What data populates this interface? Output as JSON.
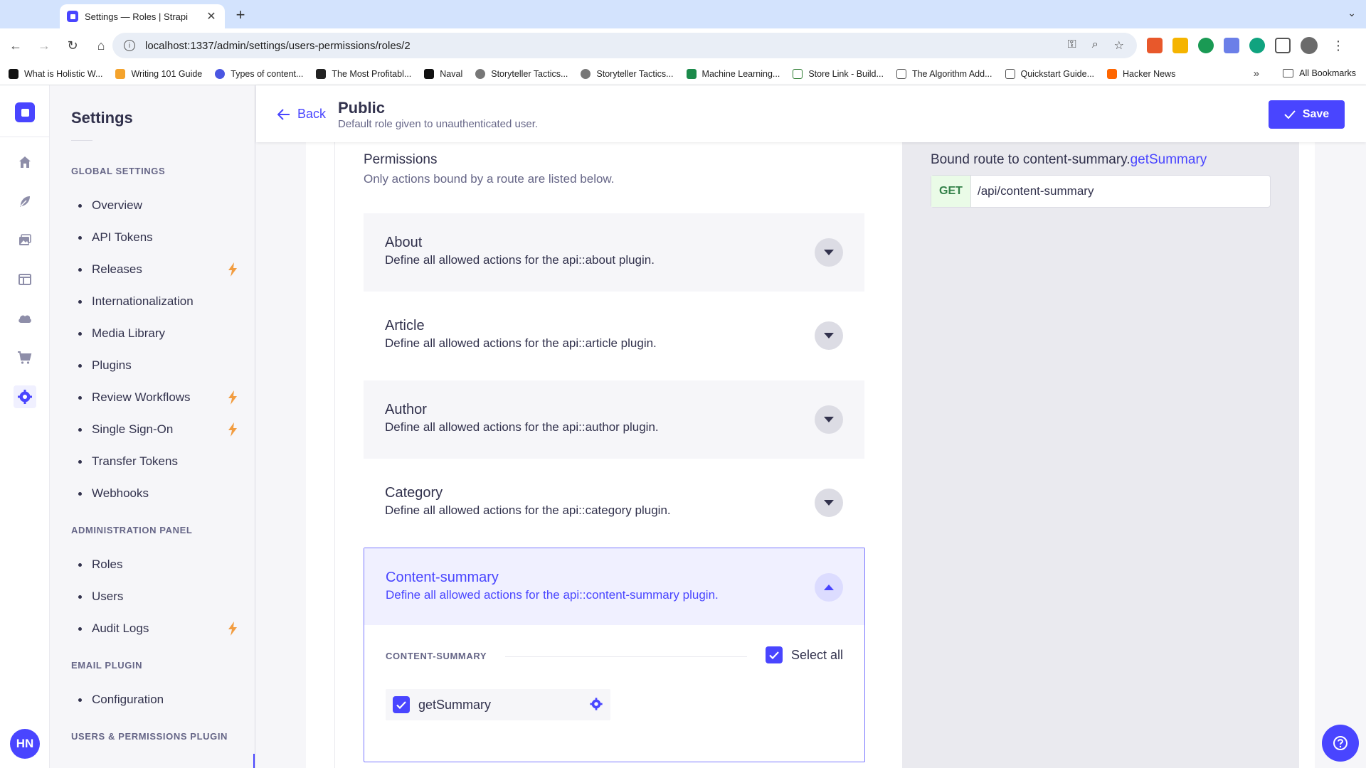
{
  "browser": {
    "tab_title": "Settings — Roles | Strapi",
    "url": "localhost:1337/admin/settings/users-permissions/roles/2",
    "bookmarks": [
      "What is Holistic W...",
      "Writing 101 Guide",
      "Types of content...",
      "The Most Profitabl...",
      "Naval",
      "Storyteller Tactics...",
      "Storyteller Tactics...",
      "Machine Learning...",
      "Store Link - Build...",
      "The Algorithm Add...",
      "Quickstart Guide...",
      "Hacker News"
    ],
    "all_bookmarks": "All Bookmarks"
  },
  "mainnav": {
    "icons": [
      "home-icon",
      "feather-icon",
      "media-icon",
      "layout-icon",
      "cloud-icon",
      "cart-icon",
      "settings-icon"
    ],
    "avatar_initials": "HN"
  },
  "subnav": {
    "title": "Settings",
    "global_label": "GLOBAL SETTINGS",
    "global_items": [
      "Overview",
      "API Tokens",
      "Releases",
      "Internationalization",
      "Media Library",
      "Plugins",
      "Review Workflows",
      "Single Sign-On",
      "Transfer Tokens",
      "Webhooks"
    ],
    "admin_label": "ADMINISTRATION PANEL",
    "admin_items": [
      "Roles",
      "Users",
      "Audit Logs"
    ],
    "email_label": "EMAIL PLUGIN",
    "email_items": [
      "Configuration"
    ],
    "up_label": "USERS & PERMISSIONS PLUGIN"
  },
  "header": {
    "back_label": "Back",
    "title": "Public",
    "subtitle": "Default role given to unauthenticated user.",
    "save_label": "Save"
  },
  "permissions": {
    "title": "Permissions",
    "description": "Only actions bound by a route are listed below.",
    "sections": [
      {
        "title": "About",
        "description": "Define all allowed actions for the api::about plugin."
      },
      {
        "title": "Article",
        "description": "Define all allowed actions for the api::article plugin."
      },
      {
        "title": "Author",
        "description": "Define all allowed actions for the api::author plugin."
      },
      {
        "title": "Category",
        "description": "Define all allowed actions for the api::category plugin."
      }
    ],
    "open_section": {
      "title": "Content-summary",
      "description": "Define all allowed actions for the api::content-summary plugin.",
      "group_label": "CONTENT-SUMMARY",
      "select_all_label": "Select all",
      "action_label": "getSummary"
    }
  },
  "bound_route": {
    "prefix": "Bound route to content-summary.",
    "highlight": "getSummary",
    "method": "GET",
    "path": "/api/content-summary"
  },
  "colors": {
    "primary": "#4945ff",
    "lightning": "#f29d41"
  }
}
